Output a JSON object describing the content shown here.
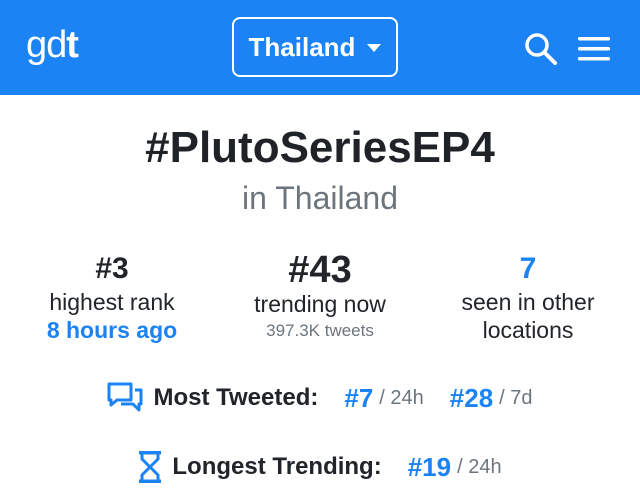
{
  "navbar": {
    "logo_prefix": "gd",
    "logo_suffix": "t",
    "country_label": "Thailand",
    "icons": [
      "search-icon",
      "menu-icon",
      "chevron-down-icon"
    ],
    "accent_color": "#1b83f4"
  },
  "hashtag": {
    "title": "#PlutoSeriesEP4",
    "location_text": "in Thailand"
  },
  "stats": {
    "highest": {
      "value": "#3",
      "label": "highest rank",
      "when": "8 hours ago"
    },
    "current": {
      "value": "#43",
      "label": "trending now",
      "tweets": "397.3K tweets"
    },
    "locations": {
      "value": "7",
      "label_line1": "seen in other",
      "label_line2": "locations"
    }
  },
  "most_tweeted": {
    "icon": "chat-bubbles-icon",
    "label": "Most Tweeted:",
    "rank_24h": "#7",
    "period_24h": "/ 24h",
    "rank_7d": "#28",
    "period_7d": "/ 7d"
  },
  "longest_trending": {
    "icon": "hourglass-icon",
    "label": "Longest Trending:",
    "rank_24h": "#19",
    "period_24h": "/ 24h"
  }
}
